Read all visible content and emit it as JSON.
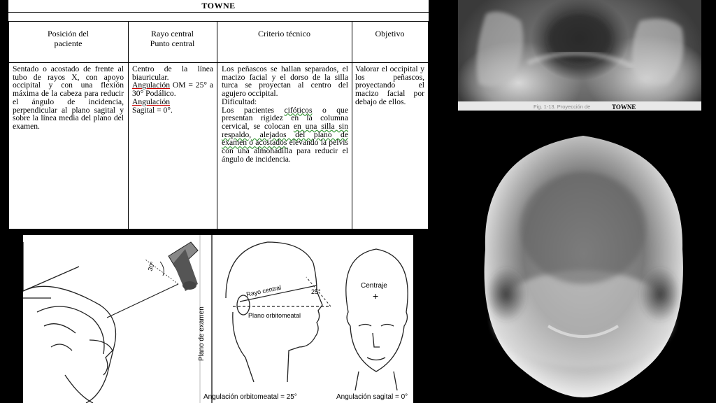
{
  "table": {
    "title": "TOWNE",
    "headers": [
      [
        "Posición del",
        "paciente"
      ],
      [
        "Rayo central",
        "Punto central"
      ],
      [
        "Criterio técnico",
        ""
      ],
      [
        "Objetivo",
        ""
      ]
    ],
    "col1": "Sentado o acostado de frente al tubo de rayos X, con apoyo occipital y con una flexión máxima de la cabeza para reducir el ángulo de incidencia, perpendicular al plano sagital y sobre la línea media del plano del examen.",
    "col2": {
      "p1": "Centro de la línea biauricular.",
      "ang_om_label": "Angulación",
      "ang_om_rest": " OM = 25° a 30° Podálico.",
      "ang_sag_label": "Angulación",
      "ang_sag_rest": "Sagital = 0°."
    },
    "col3": {
      "p1": "Los peñascos se hallan separados, el macizo facial y el dorso de la silla turca se proyectan al centro del agujero occipital.",
      "p2": "Dificultad:",
      "p3a": "Los pacientes ",
      "p3b": "cifóticos",
      "p3c": " o que presentan rigidez en la columna cervical, se colocan ",
      "p3d": "en una silla sin respaldo, alejados del plano de examen o acostados",
      "p3e": " elevando la pelvis con una almohadilla para reducir el ángulo de incidencia."
    },
    "col4": "Valorar el occipital y los peñascos, proyectando el macizo facial por debajo de ellos."
  },
  "figure_caption": {
    "prefix": "Fig. 1-13.   Proyección de",
    "title": "TOWNE"
  },
  "illustration": {
    "angle_tube": "30°",
    "plano_examen": "Plano de examen",
    "rayo_central": "Rayo central",
    "angle_25": "25°",
    "plano_orbitomeatal": "Plano orbitomeatal",
    "centraje": "Centraje",
    "ang_orbitomeatal": "Angulación orbitomeatal = 25°",
    "ang_sagital": "Angulación sagital = 0°"
  }
}
